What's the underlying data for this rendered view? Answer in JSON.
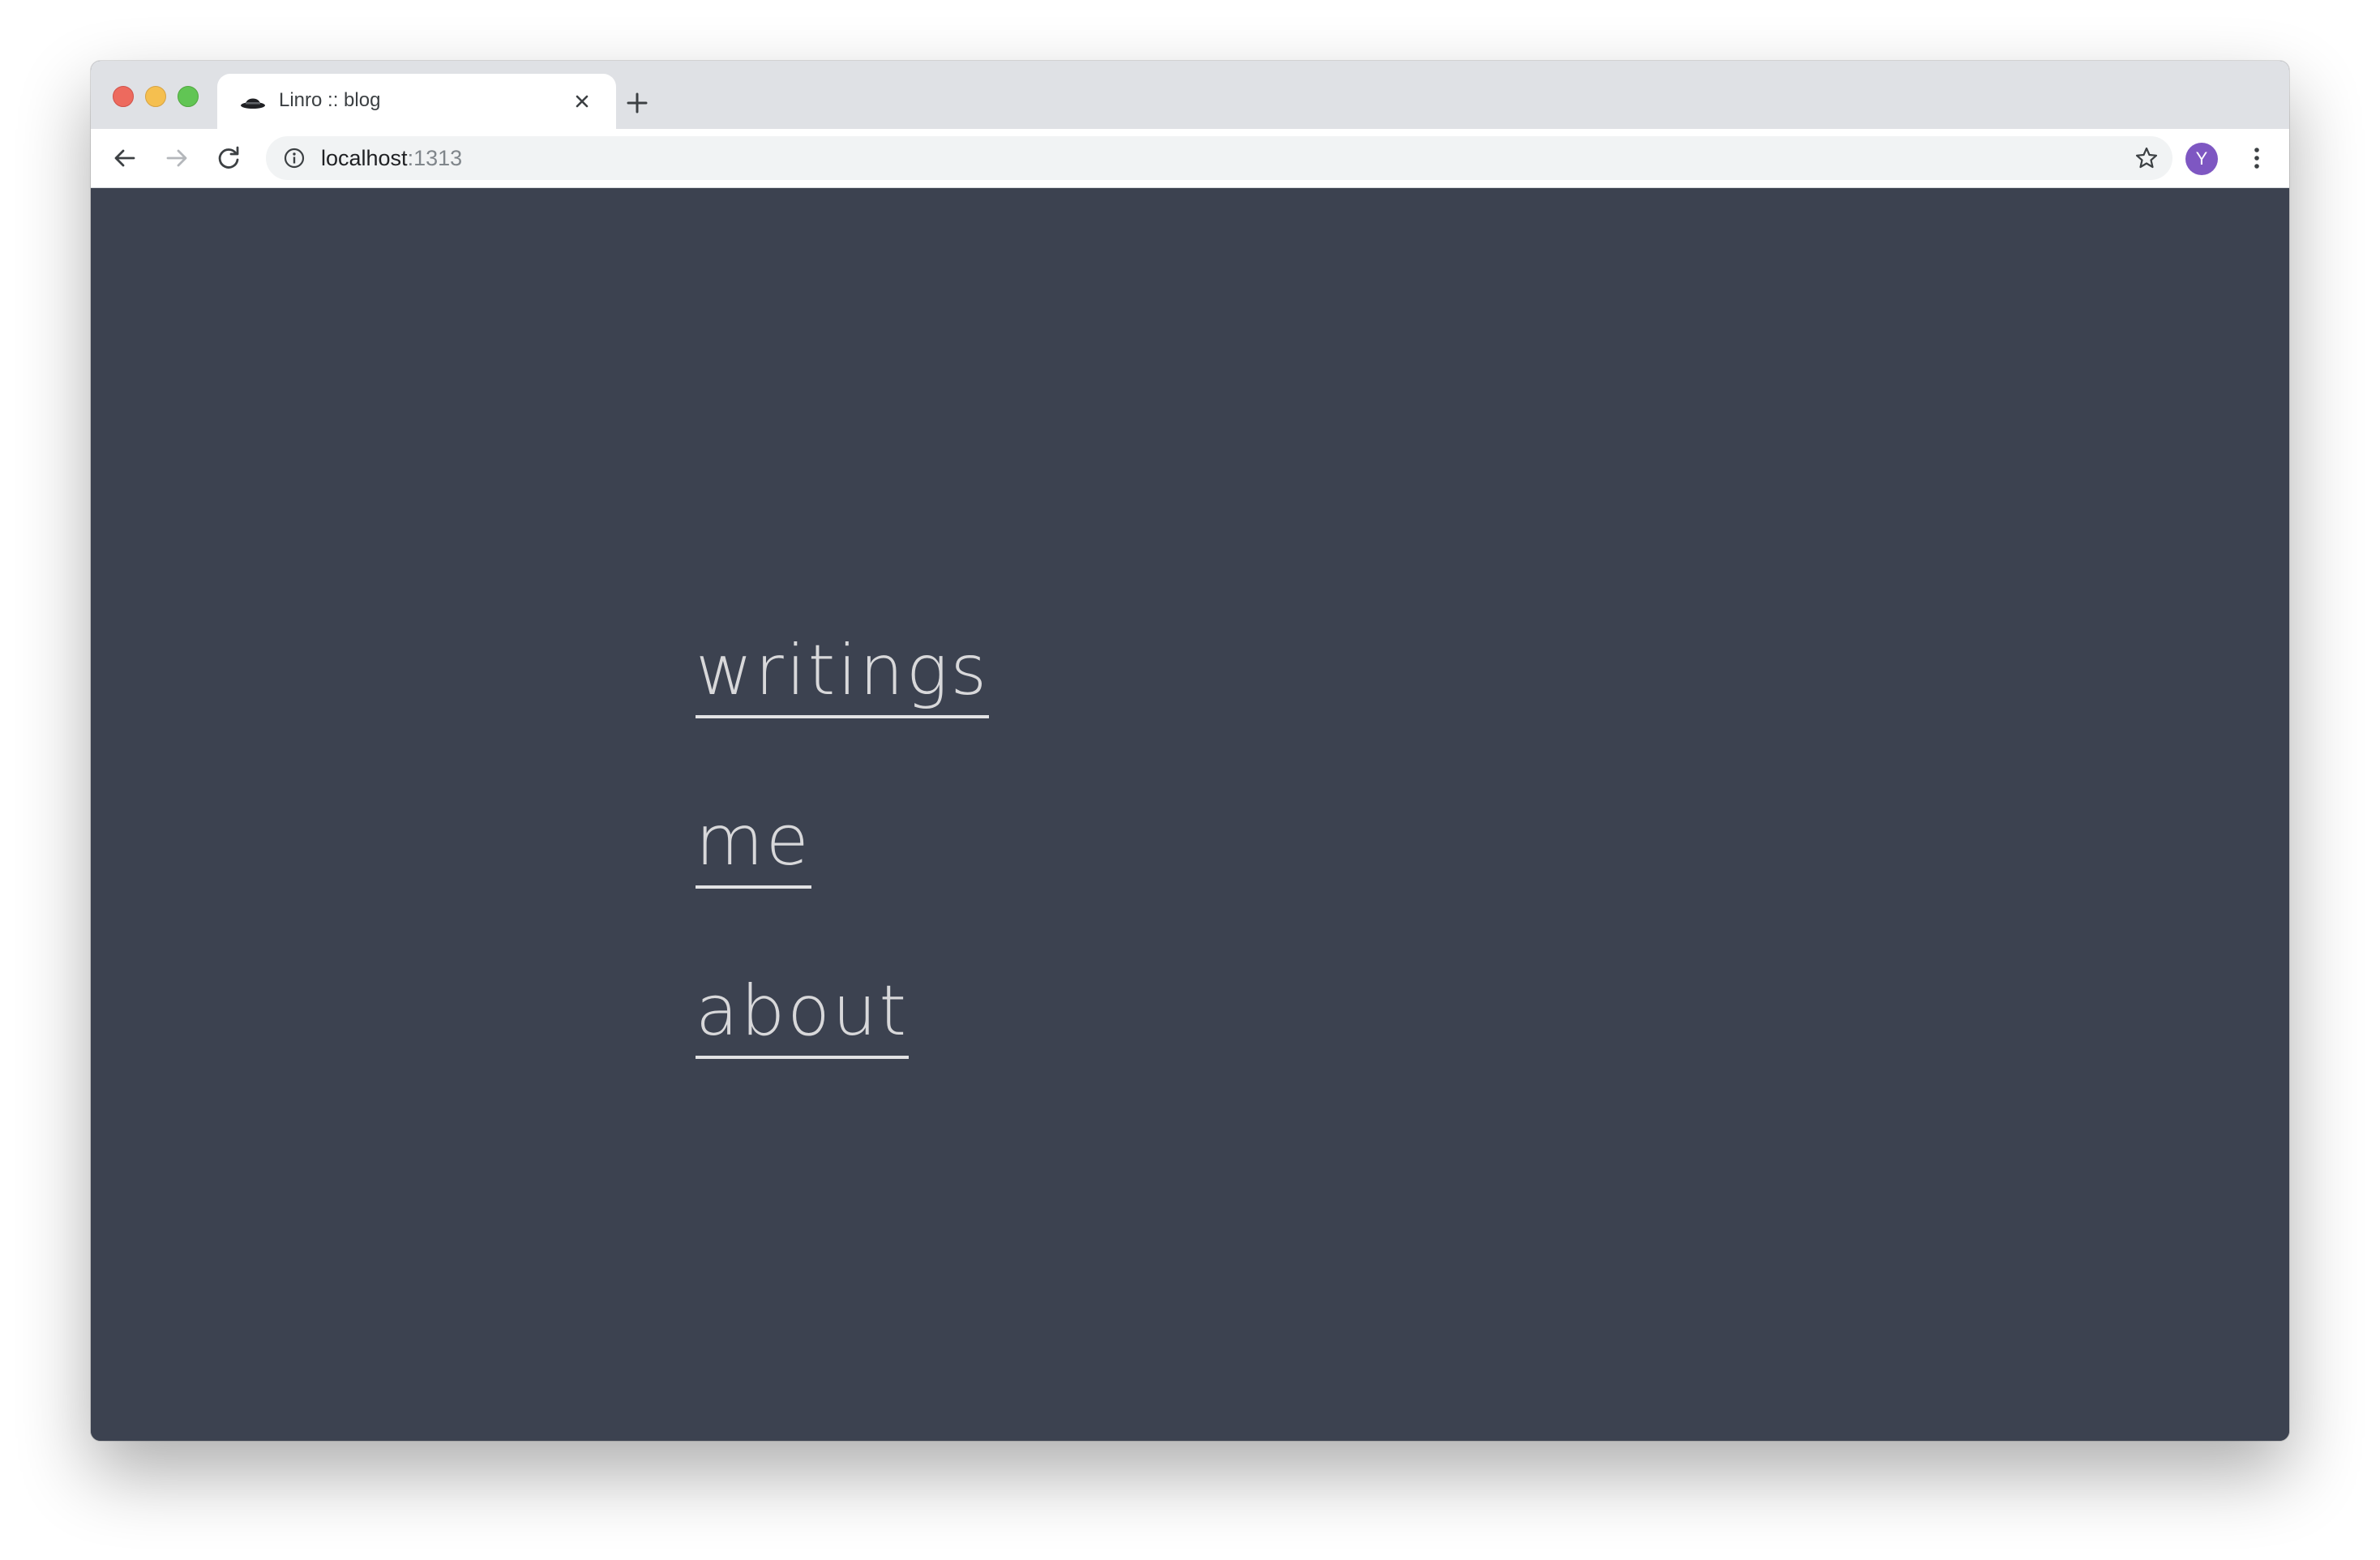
{
  "browser": {
    "tab": {
      "title": "Linro :: blog",
      "favicon": "bowler-hat-icon"
    },
    "address_bar": {
      "host": "localhost",
      "port": ":1313"
    },
    "profile_initial": "Y",
    "colors": {
      "avatar": "#7e57c2",
      "titlebar": "#dfe1e5"
    }
  },
  "page": {
    "background": "#3c4250",
    "nav": [
      {
        "label": "writings"
      },
      {
        "label": "me"
      },
      {
        "label": "about"
      }
    ]
  }
}
